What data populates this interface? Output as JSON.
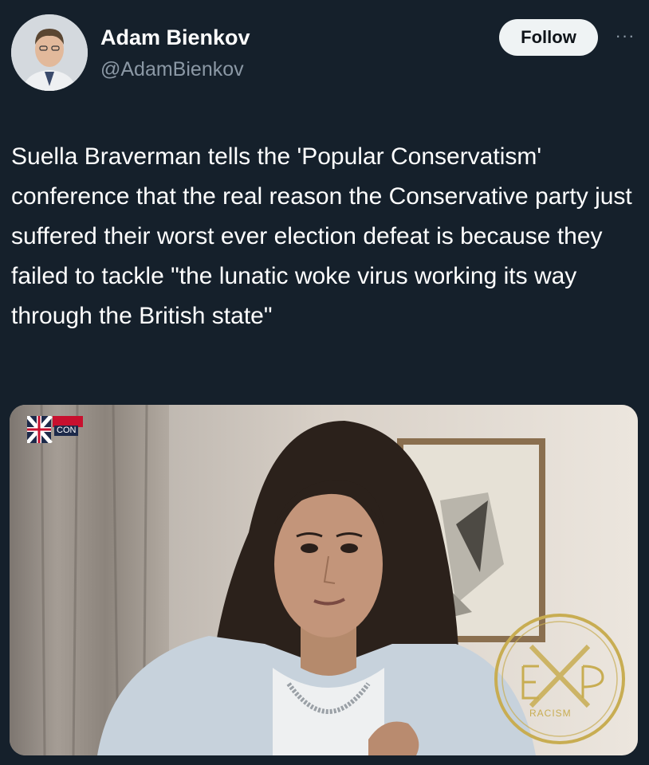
{
  "tweet": {
    "author": {
      "name": "Adam Bienkov",
      "handle": "@AdamBienkov"
    },
    "follow_label": "Follow",
    "more_label": "···",
    "text": "Suella Braverman tells the 'Popular Conservatism' conference that the real reason the Conservative party just suffered their worst ever election defeat is because they failed to tackle \"the lunatic woke virus working its way through the British state\""
  },
  "media": {
    "logo_text": "CON",
    "watermark_text": "RACISM"
  },
  "colors": {
    "background": "#15202b",
    "primary_text": "#ffffff",
    "secondary_text": "#8b98a5",
    "follow_button": "#eff3f4"
  }
}
